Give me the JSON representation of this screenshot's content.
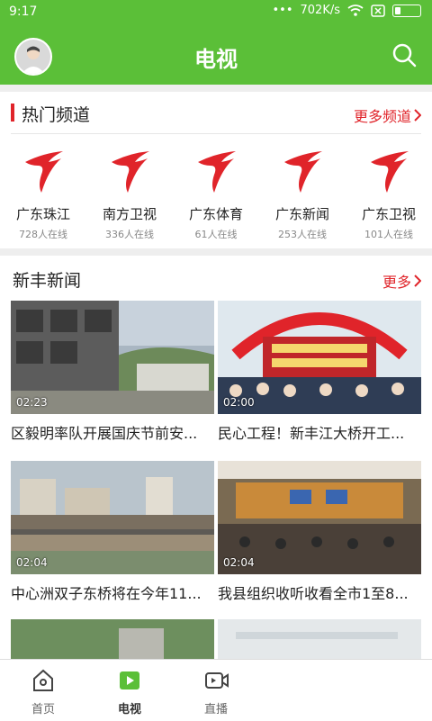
{
  "status": {
    "time": "9:17",
    "speed": "702K/s"
  },
  "header": {
    "title": "电视"
  },
  "hot_section": {
    "title": "热门频道",
    "more": "更多频道"
  },
  "channels": [
    {
      "name": "广东珠江",
      "online": "728人在线"
    },
    {
      "name": "南方卫视",
      "online": "336人在线"
    },
    {
      "name": "广东体育",
      "online": "61人在线"
    },
    {
      "name": "广东新闻",
      "online": "253人在线"
    },
    {
      "name": "广东卫视",
      "online": "101人在线"
    }
  ],
  "news_section": {
    "title": "新丰新闻",
    "more": "更多"
  },
  "news": [
    {
      "title": "区毅明率队开展国庆节前安...",
      "duration": "02:23"
    },
    {
      "title": "民心工程！新丰江大桥开工...",
      "duration": "02:00"
    },
    {
      "title": "中心洲双子东桥将在今年11...",
      "duration": "02:04"
    },
    {
      "title": "我县组织收听收看全市1至8...",
      "duration": "02:04"
    }
  ],
  "tabs": [
    {
      "label": "首页",
      "icon": "home-icon"
    },
    {
      "label": "电视",
      "icon": "tv-icon"
    },
    {
      "label": "直播",
      "icon": "live-icon"
    }
  ],
  "colors": {
    "brand_green": "#5bbf38",
    "accent_red": "#e0242a"
  }
}
